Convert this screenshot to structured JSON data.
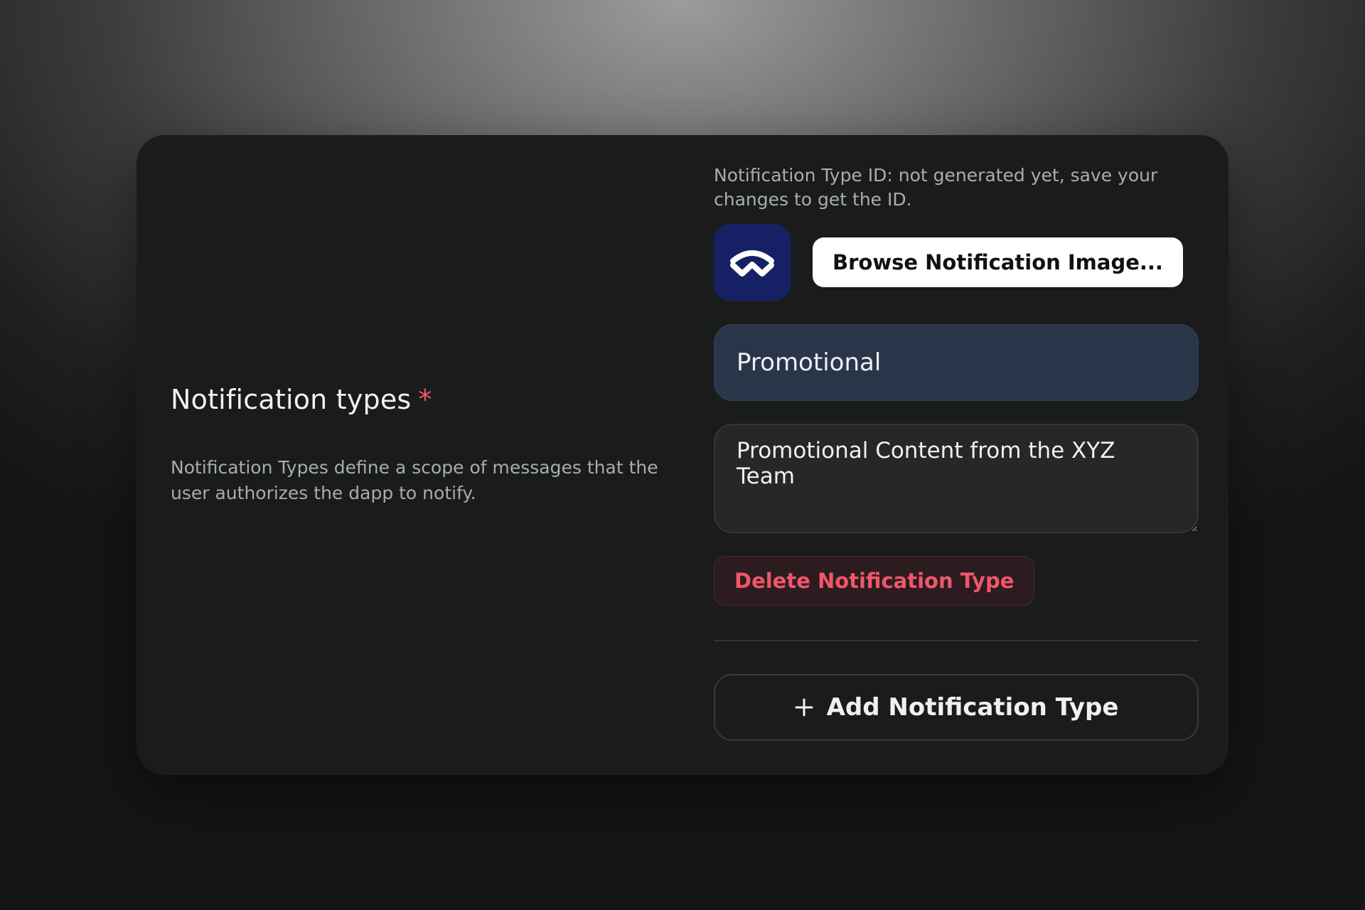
{
  "section": {
    "title": "Notification types",
    "required_marker": "*",
    "description": "Notification Types define a scope of messages that the user authorizes the dapp to notify."
  },
  "notification_type": {
    "id_text": "Notification Type ID: not generated yet, save your changes to get the ID.",
    "logo_icon": "walletconnect-logo-icon",
    "browse_label": "Browse Notification Image...",
    "name_value": "Promotional",
    "description_value": "Promotional Content from the XYZ Team",
    "delete_label": "Delete Notification Type"
  },
  "actions": {
    "add_label": "Add Notification Type",
    "add_icon": "plus-icon"
  },
  "colors": {
    "card_background": "#1a1c1c",
    "logo_tile": "#162065",
    "name_input_background": "#29364a",
    "danger": "#f0566b",
    "primary_button": "#ffffff"
  }
}
